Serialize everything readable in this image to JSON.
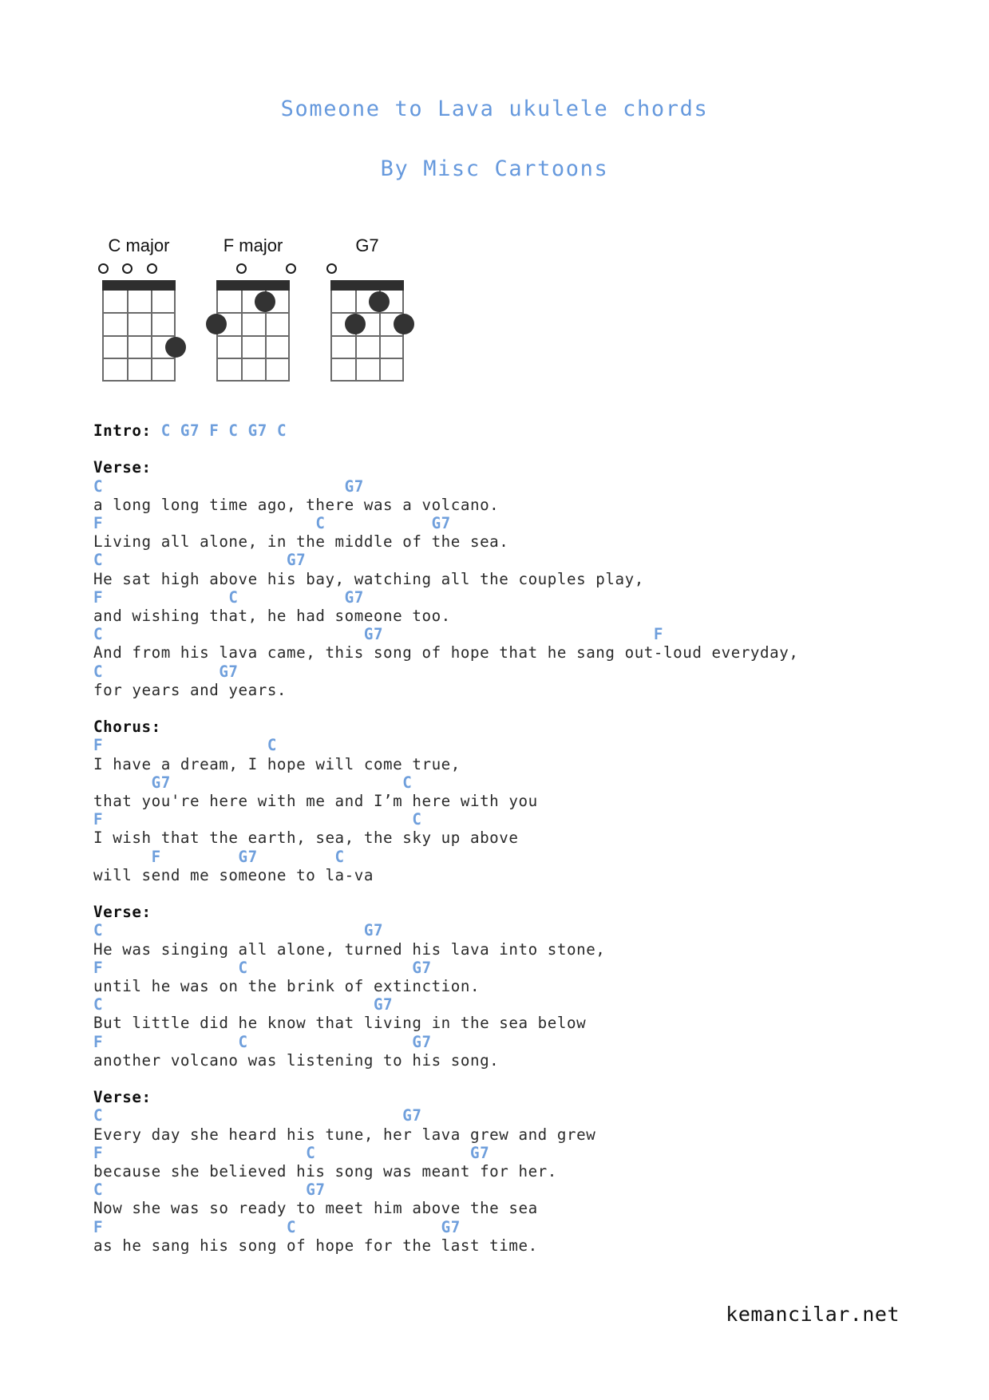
{
  "page": {
    "title": "Someone to Lava ukulele chords",
    "byline": "By Misc Cartoons",
    "footer": "kemancilar.net",
    "colors": {
      "heading": "#6699dd",
      "chord": "#6f9fdc",
      "lyric": "#2a2a2a",
      "label": "#0f0f0f",
      "diagram": "#2e2e2e"
    }
  },
  "chord_diagrams": [
    {
      "name": "C major",
      "strings": 4,
      "frets": 4,
      "open_strings": [
        1,
        2,
        3
      ],
      "muted_strings": [],
      "dots": [
        {
          "string": 4,
          "fret": 3
        }
      ]
    },
    {
      "name": "F major",
      "strings": 4,
      "frets": 4,
      "open_strings": [
        2,
        4
      ],
      "muted_strings": [],
      "dots": [
        {
          "string": 3,
          "fret": 1
        },
        {
          "string": 1,
          "fret": 2
        }
      ]
    },
    {
      "name": "G7",
      "strings": 4,
      "frets": 4,
      "open_strings": [
        1
      ],
      "muted_strings": [],
      "dots": [
        {
          "string": 3,
          "fret": 1
        },
        {
          "string": 2,
          "fret": 2
        },
        {
          "string": 4,
          "fret": 2
        }
      ]
    }
  ],
  "intro": {
    "label": "Intro:",
    "chords": "C G7 F C G7 C",
    "full": "Intro: C G7 F C G7 C"
  },
  "sections": [
    {
      "label": "Verse:",
      "lines": [
        {
          "chords": "C                         G7",
          "lyrics": "a long long time ago, there was a volcano."
        },
        {
          "chords": "F                      C           G7",
          "lyrics": "Living all alone, in the middle of the sea."
        },
        {
          "chords": "C                   G7",
          "lyrics": "He sat high above his bay, watching all the couples play,"
        },
        {
          "chords": "F             C           G7",
          "lyrics": "and wishing that, he had someone too."
        },
        {
          "chords": "C                           G7                            F",
          "lyrics": "And from his lava came, this song of hope that he sang out-loud everyday,"
        },
        {
          "chords": "C            G7",
          "lyrics": "for years and years."
        }
      ]
    },
    {
      "label": "Chorus:",
      "lines": [
        {
          "chords": "F                 C",
          "lyrics": "I have a dream, I hope will come true,"
        },
        {
          "chords": "      G7                        C",
          "lyrics": "that you're here with me and I’m here with you"
        },
        {
          "chords": "F                                C",
          "lyrics": "I wish that the earth, sea, the sky up above"
        },
        {
          "chords": "      F        G7        C",
          "lyrics": "will send me someone to la-va"
        }
      ]
    },
    {
      "label": "Verse:",
      "lines": [
        {
          "chords": "C                           G7",
          "lyrics": "He was singing all alone, turned his lava into stone,"
        },
        {
          "chords": "F              C                 G7",
          "lyrics": "until he was on the brink of extinction."
        },
        {
          "chords": "C                            G7",
          "lyrics": "But little did he know that living in the sea below"
        },
        {
          "chords": "F              C                 G7",
          "lyrics": "another volcano was listening to his song."
        }
      ]
    },
    {
      "label": "Verse:",
      "lines": [
        {
          "chords": "C                               G7",
          "lyrics": "Every day she heard his tune, her lava grew and grew"
        },
        {
          "chords": "F                     C                G7",
          "lyrics": "because she believed his song was meant for her."
        },
        {
          "chords": "C                     G7",
          "lyrics": "Now she was so ready to meet him above the sea"
        },
        {
          "chords": "F                   C               G7",
          "lyrics": "as he sang his song of hope for the last time."
        }
      ]
    }
  ]
}
